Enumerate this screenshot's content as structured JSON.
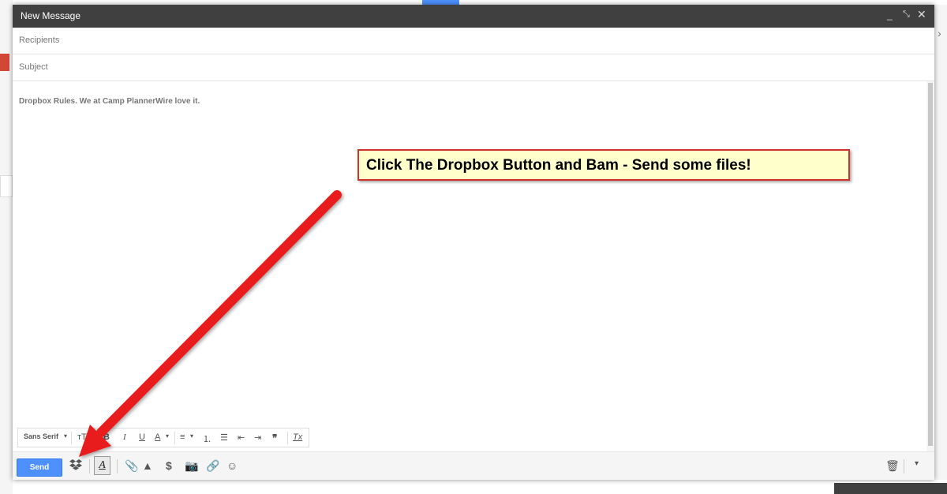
{
  "compose": {
    "title": "New Message",
    "recipients_placeholder": "Recipients",
    "subject_placeholder": "Subject",
    "body_text": "Dropbox Rules. We at Camp PlannerWire love it.",
    "send_label": "Send",
    "font_label": "Sans Serif"
  },
  "annotation": {
    "text": "Click The Dropbox Button and Bam - Send some files!",
    "arrow_color": "#e81c1c"
  },
  "colors": {
    "titlebar": "#404040",
    "send": "#4d90fe",
    "callout_bg": "#ffffcc",
    "callout_border": "#d0322b"
  },
  "icons": {
    "minimize": "minimize-icon",
    "popout": "popout-icon",
    "close": "close-icon",
    "dropbox": "dropbox-icon",
    "formatting": "formatting-toggle-icon",
    "attach": "paperclip-icon",
    "drive": "drive-icon",
    "money": "dollar-icon",
    "photo": "camera-icon",
    "link": "link-icon",
    "emoji": "smiley-icon",
    "discard": "trash-icon",
    "more": "chevron-down-icon"
  }
}
